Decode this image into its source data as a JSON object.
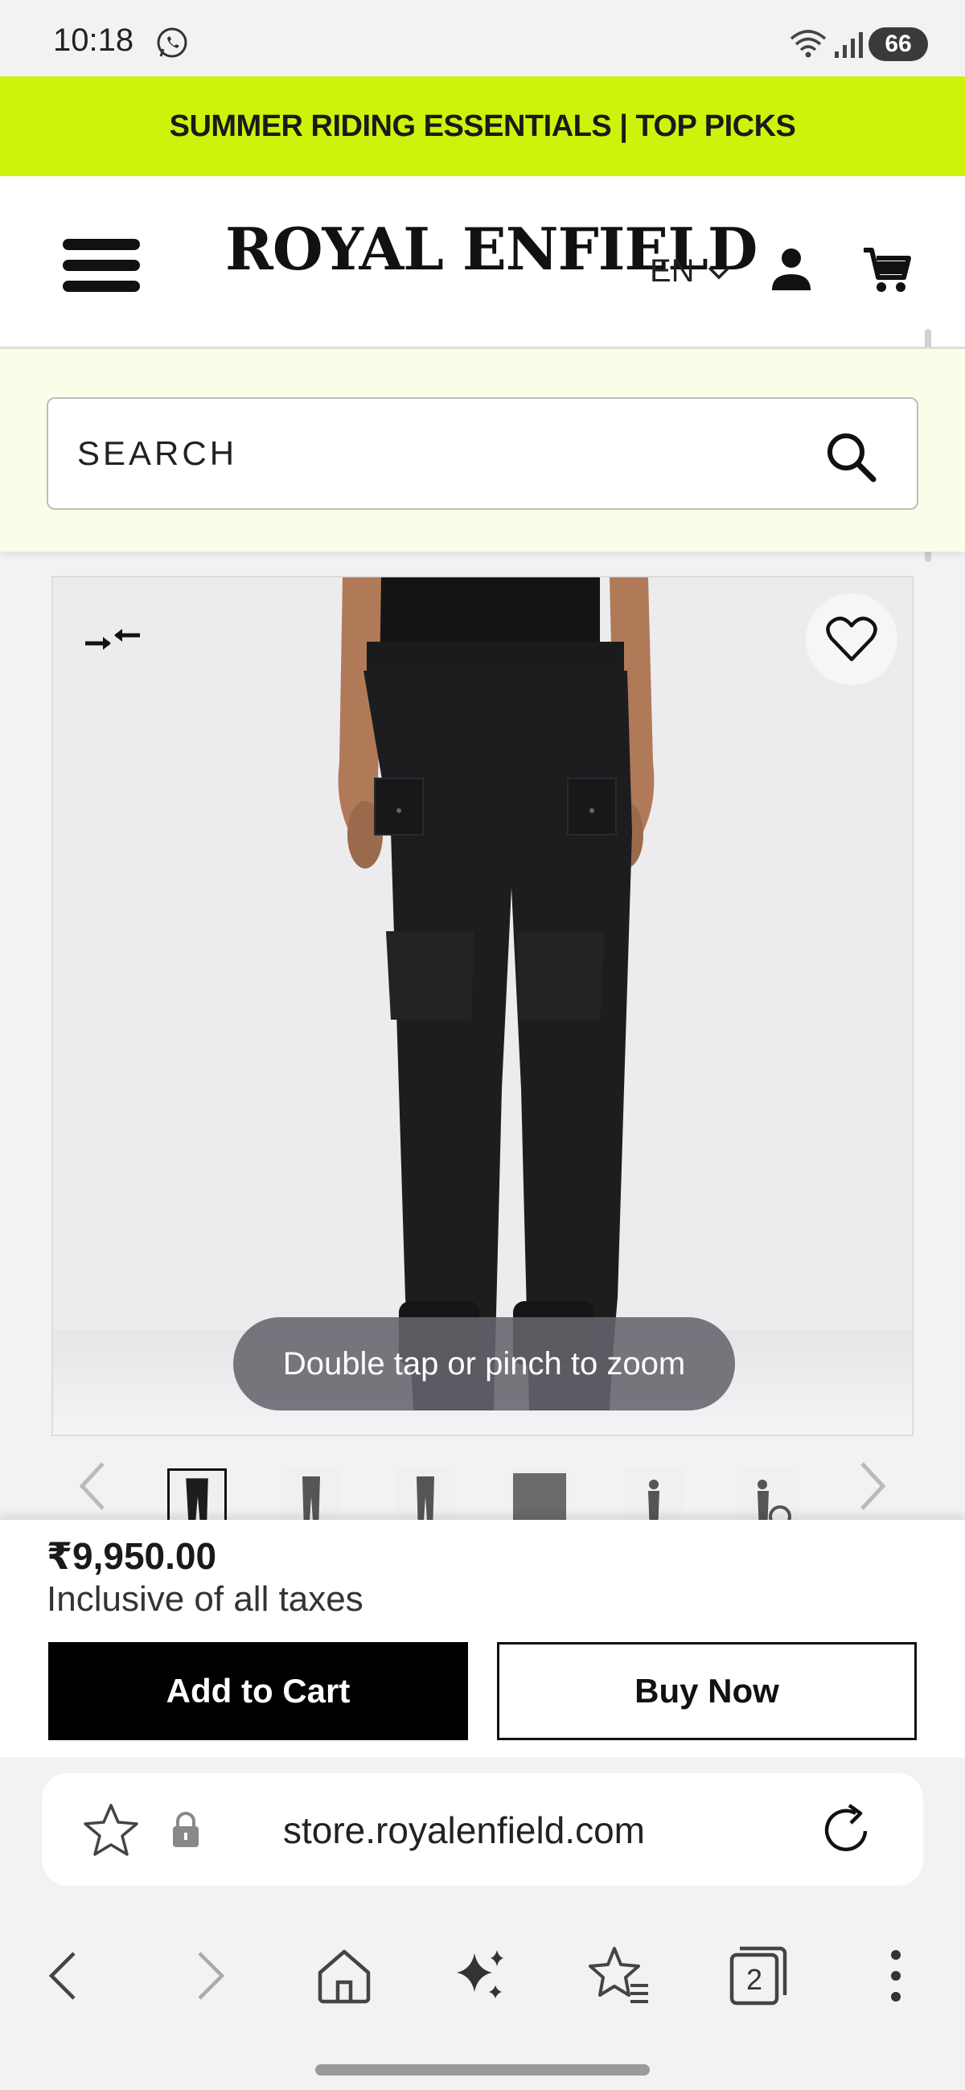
{
  "status_bar": {
    "time": "10:18",
    "battery": "66",
    "icons": [
      "whatsapp-icon",
      "wifi-icon",
      "signal-icon"
    ]
  },
  "promo": {
    "text": "SUMMER RIDING ESSENTIALS | TOP PICKS",
    "background": "#cdf30b"
  },
  "header": {
    "logo": "ROYAL ENFIELD",
    "language": "EN",
    "icons": [
      "menu-icon",
      "user-icon",
      "cart-icon"
    ]
  },
  "search": {
    "placeholder": "SEARCH"
  },
  "product": {
    "zoom_hint": "Double tap or pinch to zoom",
    "thumbnail_count": 6,
    "price": "₹9,950.00",
    "tax_note": "Inclusive of all taxes"
  },
  "actions": {
    "add_to_cart": "Add to Cart",
    "buy_now": "Buy Now"
  },
  "browser": {
    "url": "store.royalenfield.com",
    "tab_count": "2"
  }
}
